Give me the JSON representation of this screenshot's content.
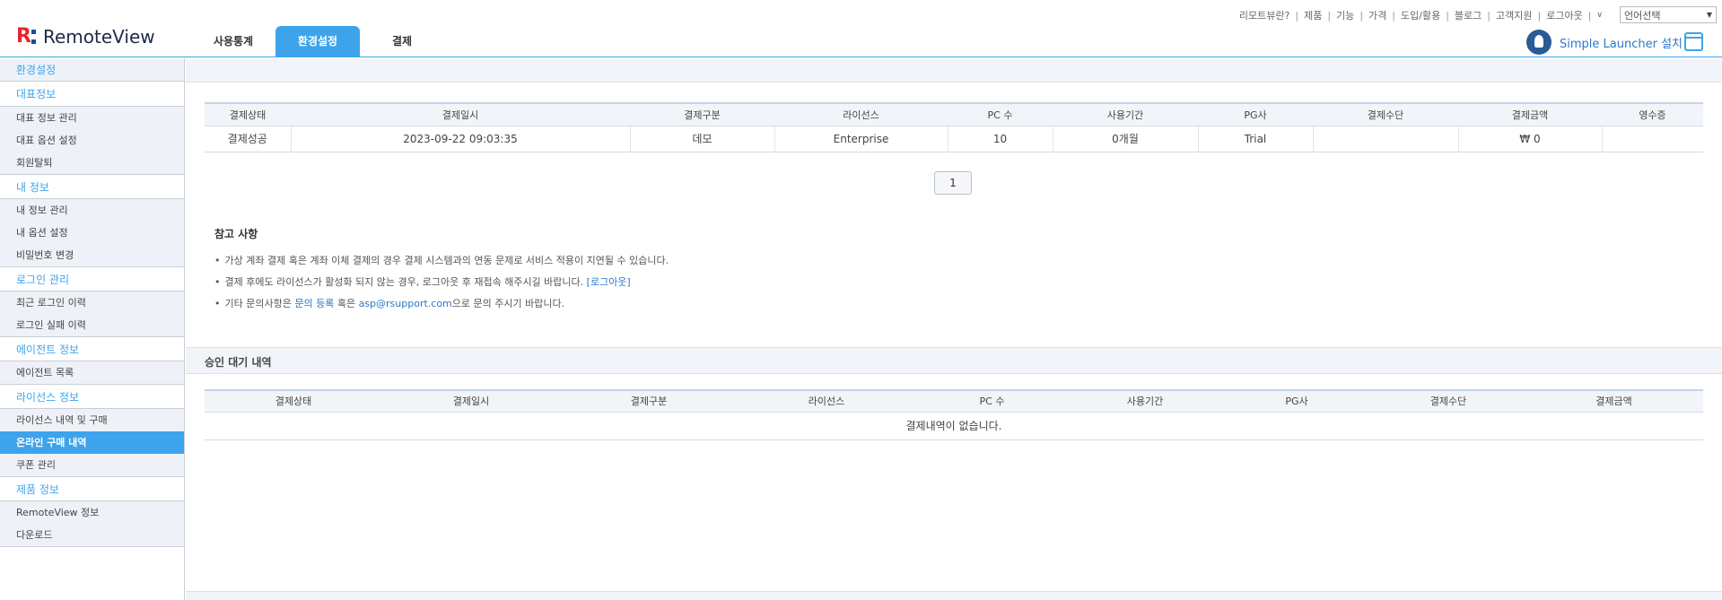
{
  "brand": {
    "name": "RemoteView"
  },
  "gnb": {
    "tabs": [
      {
        "label": "사용통계",
        "active": false
      },
      {
        "label": "환경설정",
        "active": true
      },
      {
        "label": "결제",
        "active": false
      }
    ]
  },
  "util_links": [
    "리모트뷰란?",
    "제품",
    "기능",
    "가격",
    "도입/활용",
    "블로그",
    "고객지원",
    "로그아웃"
  ],
  "language_select": {
    "value": "언어선택"
  },
  "launcher": {
    "label": "Simple Launcher 설치"
  },
  "sidebar": {
    "root": "환경설정",
    "sections": [
      {
        "title": "대표정보",
        "items": [
          "대표 정보 관리",
          "대표 옵션 설정",
          "회원탈퇴"
        ]
      },
      {
        "title": "내 정보",
        "items": [
          "내 정보 관리",
          "내 옵션 설정",
          "비밀번호 변경"
        ]
      },
      {
        "title": "로그인 관리",
        "items": [
          "최근 로그인 이력",
          "로그인 실패 이력"
        ]
      },
      {
        "title": "에이전트 정보",
        "items": [
          "에이전트 목록"
        ]
      },
      {
        "title": "라이선스 정보",
        "items": [
          "라이선스 내역 및 구매",
          "온라인 구매 내역",
          "쿠폰 관리"
        ]
      },
      {
        "title": "제품 정보",
        "items": [
          "RemoteView 정보",
          "다운로드"
        ]
      }
    ],
    "active_item": "온라인 구매 내역"
  },
  "payments": {
    "headers": [
      "결제상태",
      "결제일시",
      "결제구분",
      "라이선스",
      "PC 수",
      "사용기간",
      "PG사",
      "결제수단",
      "결제금액",
      "영수증"
    ],
    "rows": [
      [
        "결제성공",
        "2023-09-22 09:03:35",
        "데모",
        "Enterprise",
        "10",
        "0개월",
        "Trial",
        "",
        "₩ 0",
        ""
      ]
    ]
  },
  "pagination": {
    "current": "1"
  },
  "notes": {
    "title": "참고 사항",
    "line1": "가상 계좌 결제 혹은 계좌 이체 결제의 경우 결제 시스템과의 연동 문제로 서비스 적용이 지연될 수 있습니다.",
    "line2_text": "결제 후에도 라이선스가 활성화 되지 않는 경우, 로그아웃 후 재접속 해주시길 바랍니다.",
    "line2_link": "[로그아웃]",
    "line3_pre": "기타 문의사항은",
    "line3_link1": "문의 등록",
    "line3_mid": "혹은",
    "line3_link2": "asp@rsupport.com",
    "line3_post": "으로 문의 주시기 바랍니다."
  },
  "pending": {
    "title": "승인 대기 내역",
    "headers": [
      "결제상태",
      "결제일시",
      "결제구분",
      "라이선스",
      "PC 수",
      "사용기간",
      "PG사",
      "결제수단",
      "결제금액"
    ],
    "empty_message": "결제내역이 없습니다."
  },
  "colors": {
    "accent": "#3da4ec",
    "brand_red": "#e8262b",
    "brand_navy": "#1c2b46"
  }
}
